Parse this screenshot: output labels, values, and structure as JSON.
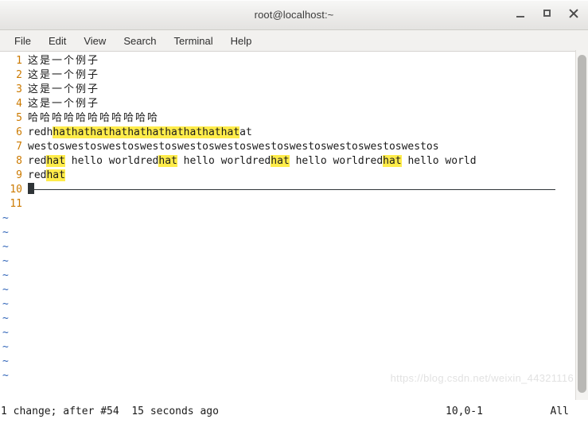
{
  "window": {
    "title": "root@localhost:~",
    "buttons": {
      "minimize": "minimize",
      "maximize": "maximize",
      "close": "close"
    }
  },
  "menu": {
    "items": [
      {
        "label": "File"
      },
      {
        "label": "Edit"
      },
      {
        "label": "View"
      },
      {
        "label": "Search"
      },
      {
        "label": "Terminal"
      },
      {
        "label": "Help"
      }
    ]
  },
  "editor": {
    "lines": [
      {
        "number": "1",
        "segments": [
          {
            "text": "这是一个例子",
            "highlight": false,
            "cjk": true
          }
        ]
      },
      {
        "number": "2",
        "segments": [
          {
            "text": "这是一个例子",
            "highlight": false,
            "cjk": true
          }
        ]
      },
      {
        "number": "3",
        "segments": [
          {
            "text": "这是一个例子",
            "highlight": false,
            "cjk": true
          }
        ]
      },
      {
        "number": "4",
        "segments": [
          {
            "text": "这是一个例子",
            "highlight": false,
            "cjk": true
          }
        ]
      },
      {
        "number": "5",
        "segments": [
          {
            "text": "哈哈哈哈哈哈哈哈哈哈哈",
            "highlight": false,
            "cjk": true
          }
        ]
      },
      {
        "number": "6",
        "segments": [
          {
            "text": "redh",
            "highlight": false,
            "cjk": false
          },
          {
            "text": "hathathathathathathathathathat",
            "highlight": true,
            "cjk": false
          },
          {
            "text": "at",
            "highlight": false,
            "cjk": false
          }
        ]
      },
      {
        "number": "7",
        "segments": [
          {
            "text": "westoswestoswestoswestoswestoswestoswestoswestoswestoswestoswestos",
            "highlight": false,
            "cjk": false
          }
        ]
      },
      {
        "number": "8",
        "segments": [
          {
            "text": "red",
            "highlight": false,
            "cjk": false
          },
          {
            "text": "hat",
            "highlight": true,
            "cjk": false
          },
          {
            "text": " hello worldred",
            "highlight": false,
            "cjk": false
          },
          {
            "text": "hat",
            "highlight": true,
            "cjk": false
          },
          {
            "text": " hello worldred",
            "highlight": false,
            "cjk": false
          },
          {
            "text": "hat",
            "highlight": true,
            "cjk": false
          },
          {
            "text": " hello worldred",
            "highlight": false,
            "cjk": false
          },
          {
            "text": "hat",
            "highlight": true,
            "cjk": false
          },
          {
            "text": " hello world",
            "highlight": false,
            "cjk": false
          }
        ]
      },
      {
        "number": "9",
        "segments": [
          {
            "text": "red",
            "highlight": false,
            "cjk": false
          },
          {
            "text": "hat",
            "highlight": true,
            "cjk": false
          }
        ]
      },
      {
        "number": "10",
        "segments": [],
        "cursor": true
      },
      {
        "number": "11",
        "segments": []
      }
    ],
    "empty_marker": "~",
    "empty_marker_count": 12,
    "colors": {
      "line_number": "#cc7a00",
      "highlight": "#ffec4a",
      "tilde": "#2f63b8",
      "text": "#1b1b1b",
      "cursor": "#2f3437",
      "background": "#ffffff"
    }
  },
  "status": {
    "message": "1 change; after #54  15 seconds ago",
    "position": "10,0-1",
    "scroll": "All"
  },
  "watermark": {
    "text": "https://blog.csdn.net/weixin_44321116"
  }
}
